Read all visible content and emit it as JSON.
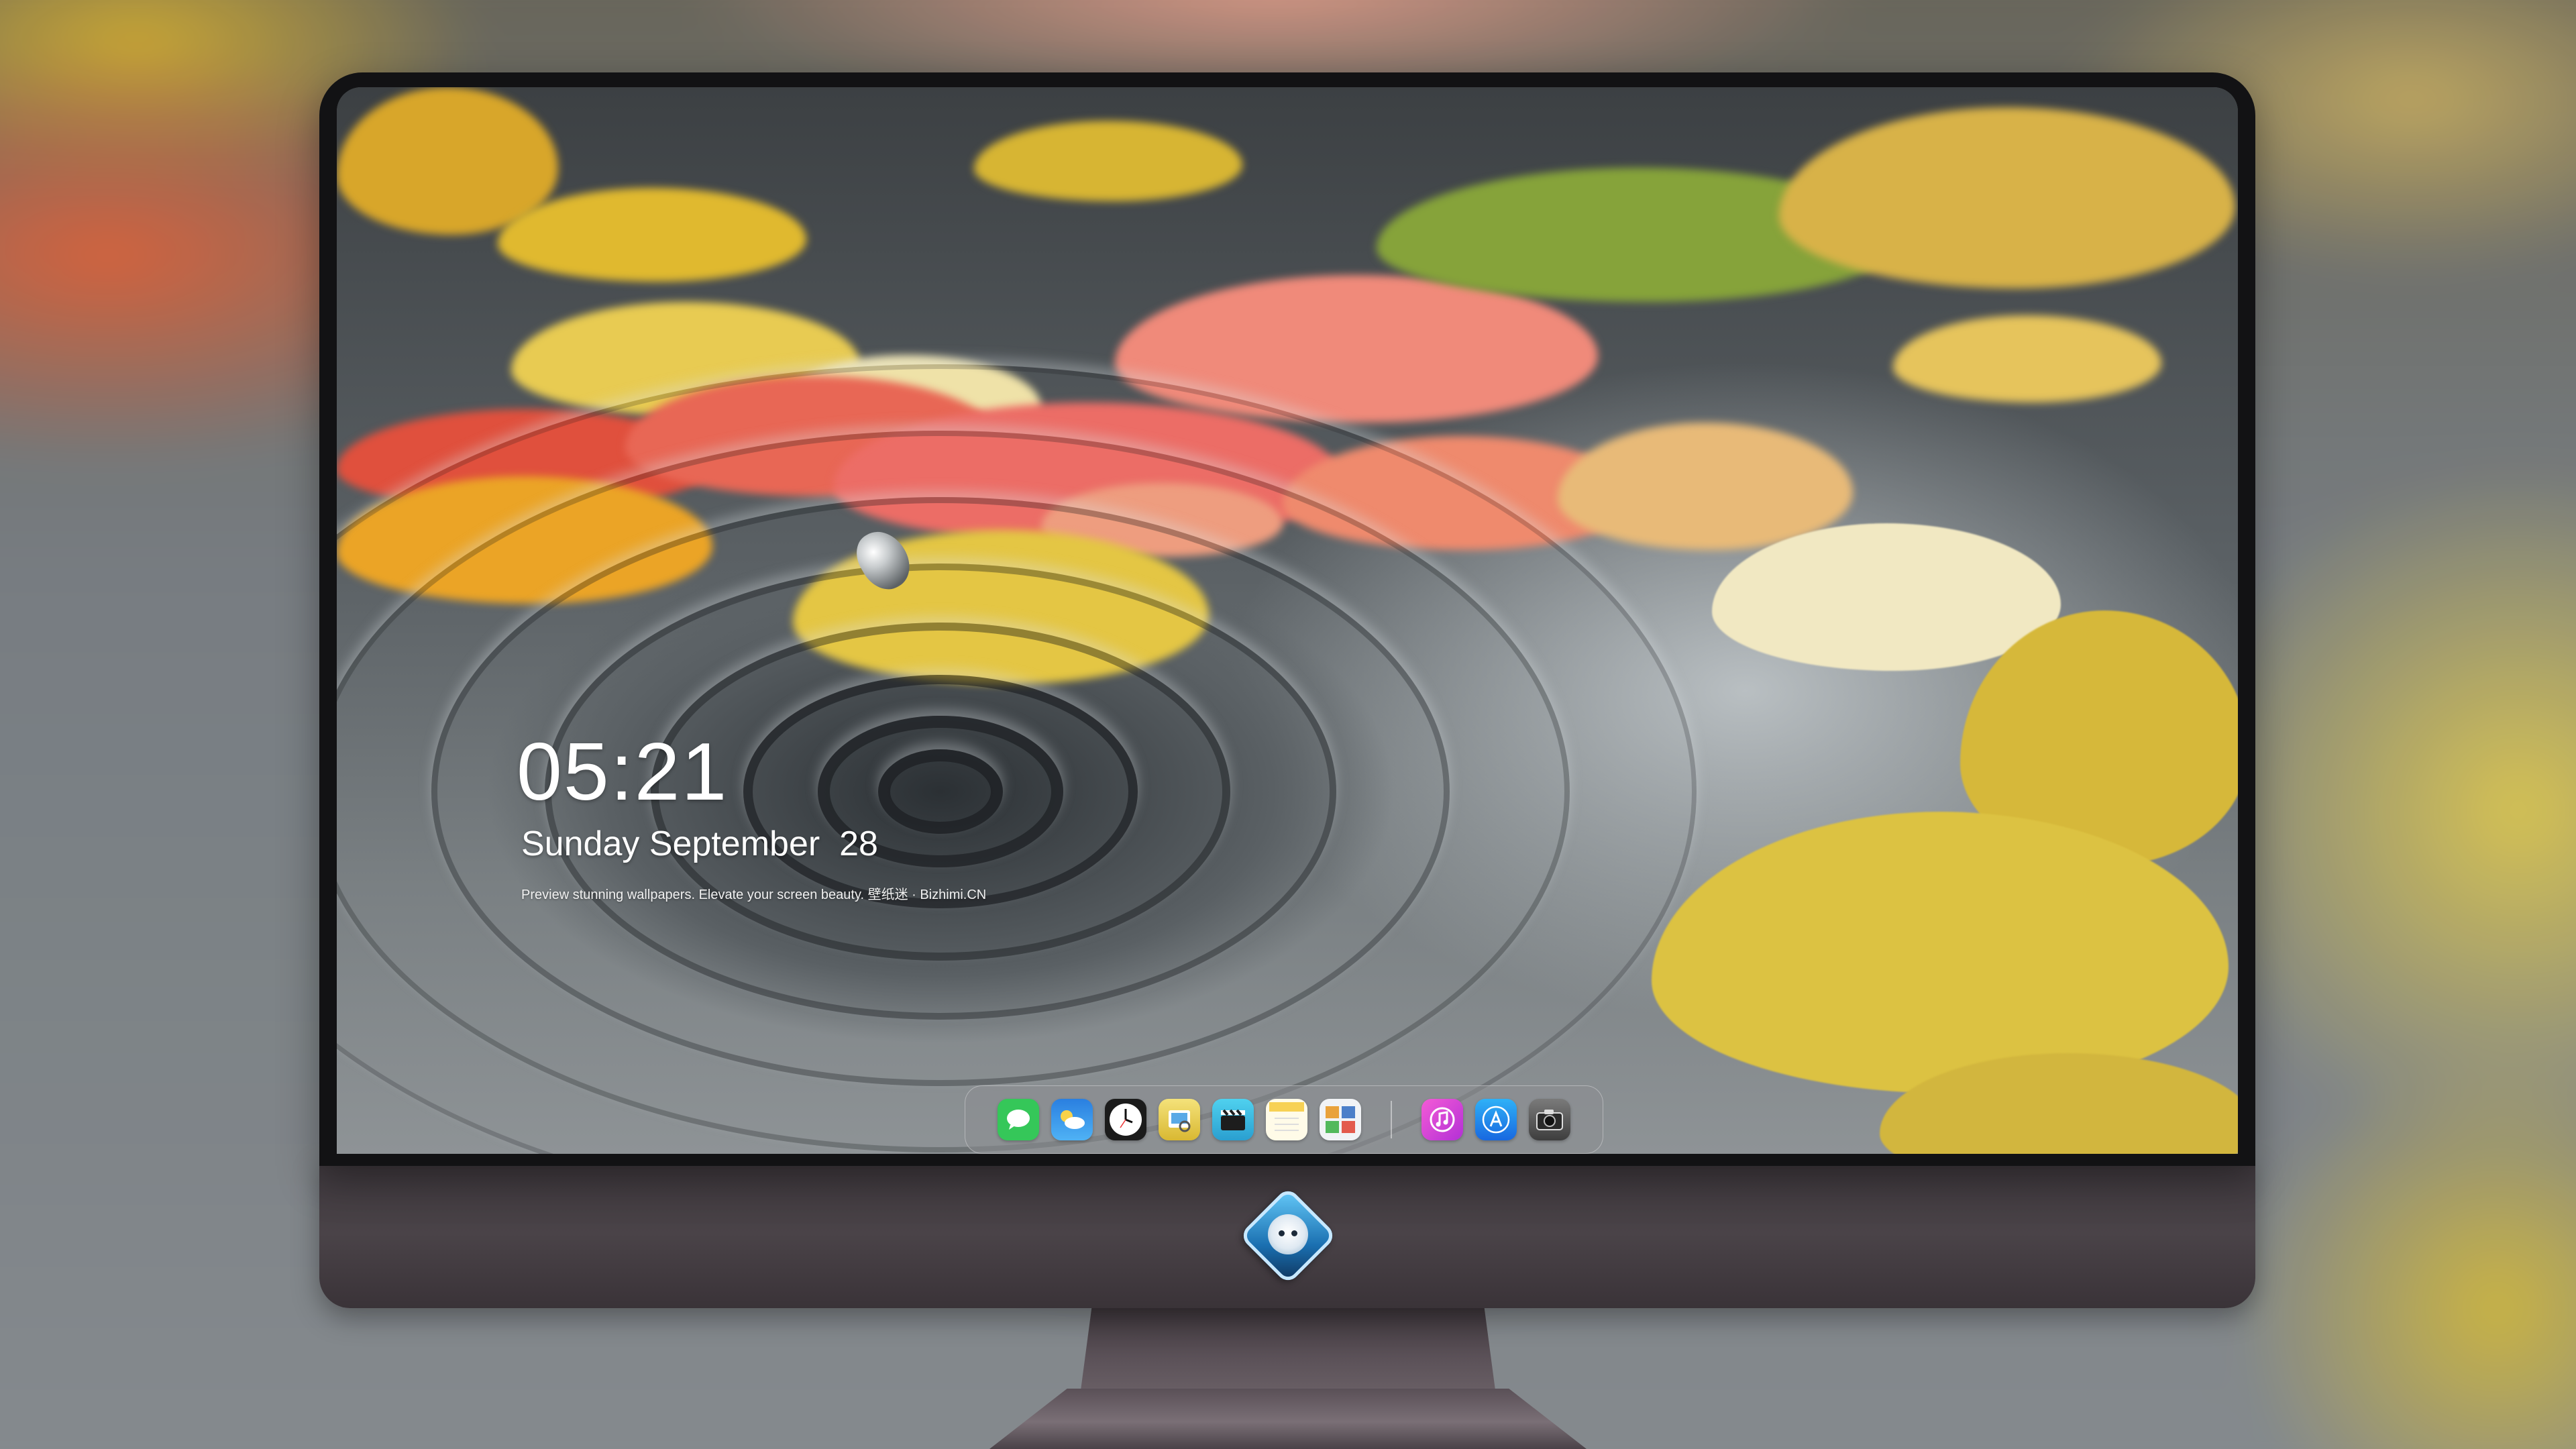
{
  "lockscreen": {
    "time": "05:21",
    "date": "Sunday September  28",
    "tagline": "Preview stunning wallpapers. Elevate your screen beauty. 壁纸迷 · Bizhimi.CN"
  },
  "dock": {
    "apps": [
      {
        "name": "Messages",
        "icon": "messages-icon",
        "color": "#35c759"
      },
      {
        "name": "Weather",
        "icon": "weather-icon",
        "color": "#2f8fe6"
      },
      {
        "name": "Clock",
        "icon": "clock-icon",
        "color": "#ffffff"
      },
      {
        "name": "Preview",
        "icon": "preview-icon",
        "color": "#e9d24a"
      },
      {
        "name": "Clips",
        "icon": "clips-icon",
        "color": "#3fc4e6"
      },
      {
        "name": "Notes",
        "icon": "notes-icon",
        "color": "#f7d154"
      },
      {
        "name": "Photo Booth",
        "icon": "photo-booth-icon",
        "color": "#4c7fc9"
      },
      {
        "name": "Music",
        "icon": "music-icon",
        "color": "#e649c9"
      },
      {
        "name": "App Store",
        "icon": "app-store-icon",
        "color": "#1e8ff0"
      },
      {
        "name": "Camera",
        "icon": "camera-icon",
        "color": "#555555"
      }
    ]
  },
  "monitor": {
    "logo": "bizhimi-mascot-logo",
    "bezel_color": "#121214",
    "chin_color": "#443d42"
  }
}
